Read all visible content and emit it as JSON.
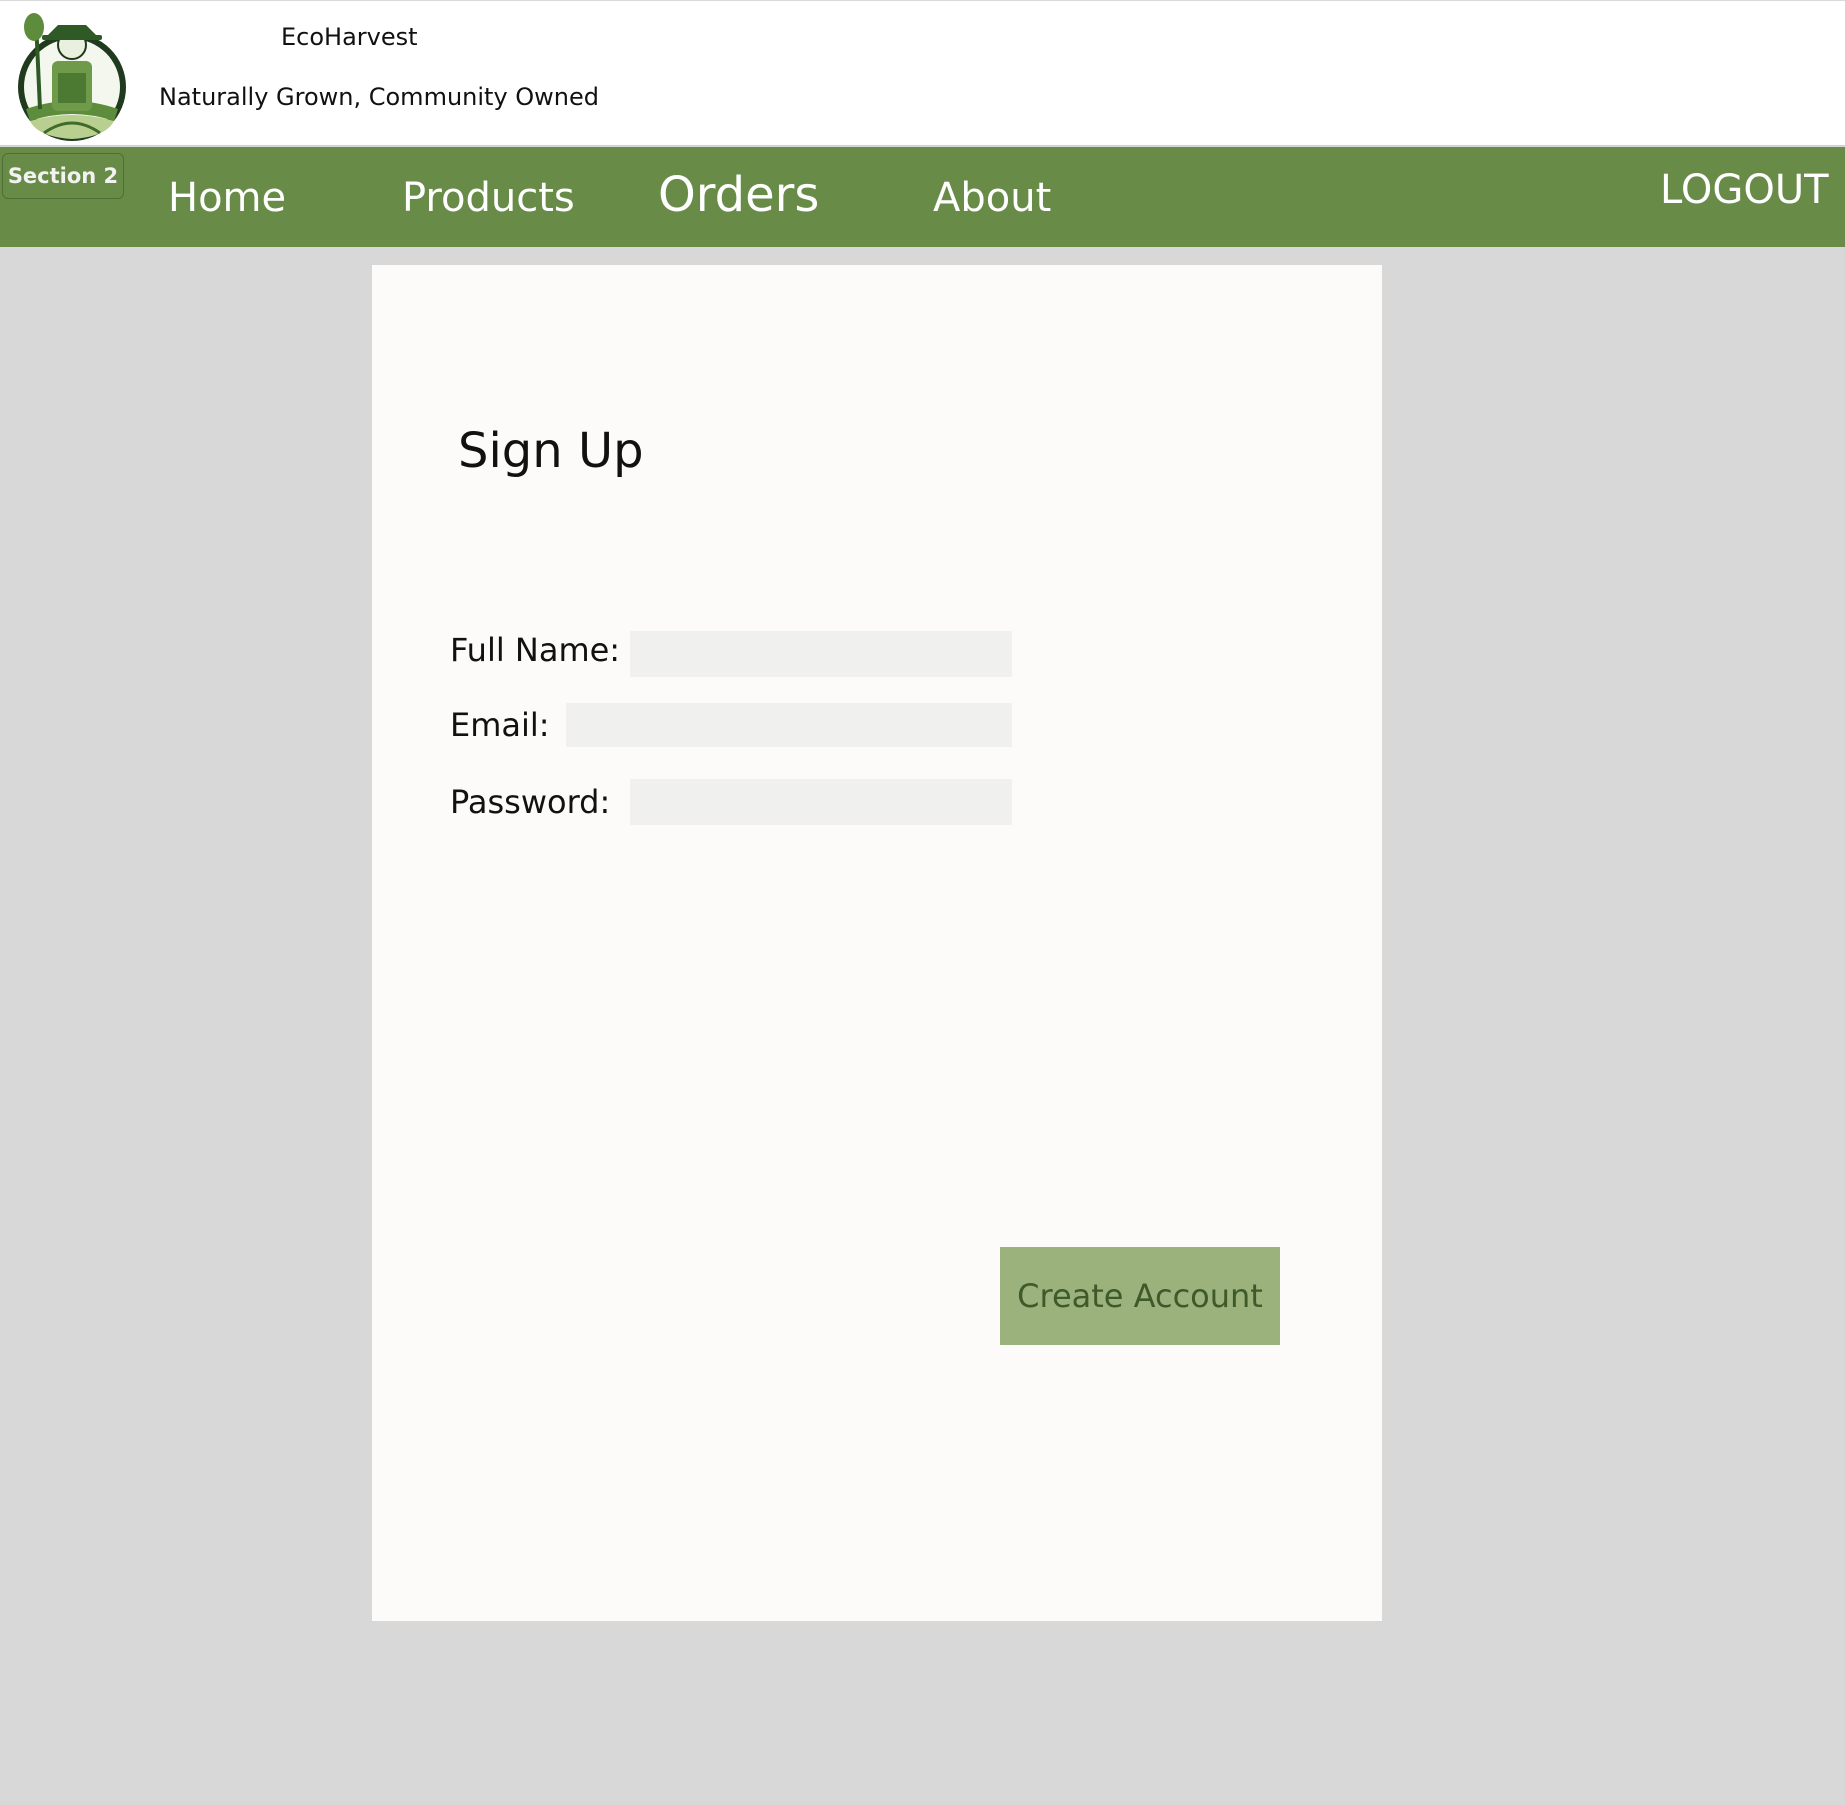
{
  "header": {
    "brand_name": "EcoHarvest",
    "tagline": "Naturally Grown, Community Owned",
    "logo_icon": "farmer-logo-icon"
  },
  "nav": {
    "section_badge": "Section 2",
    "items": [
      {
        "label": "Home"
      },
      {
        "label": "Products"
      },
      {
        "label": "Orders"
      },
      {
        "label": "About"
      }
    ],
    "logout_label": "LOGOUT"
  },
  "signup": {
    "title": "Sign Up",
    "fields": {
      "full_name": {
        "label": "Full Name:",
        "value": ""
      },
      "email": {
        "label": "Email:",
        "value": ""
      },
      "password": {
        "label": "Password:",
        "value": ""
      }
    },
    "submit_label": "Create Account"
  },
  "colors": {
    "nav_background": "#688c48",
    "page_background": "#d8d8d8",
    "panel_background": "#fdfafa",
    "button_background": "#9bb27c",
    "button_text": "#3f5a2a",
    "input_background": "#f0f0ef"
  }
}
